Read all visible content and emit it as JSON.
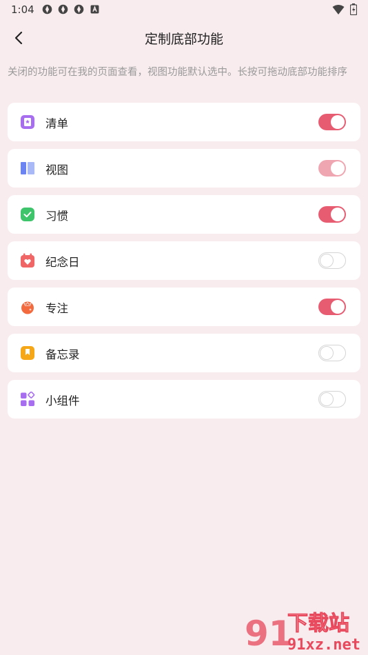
{
  "status_bar": {
    "time": "1:04",
    "icons": [
      "app-notification-icon",
      "app-notification-icon",
      "app-notification-icon",
      "a-badge-icon"
    ],
    "right_icons": [
      "wifi-icon",
      "battery-icon"
    ]
  },
  "header": {
    "back_icon": "chevron-left-icon",
    "title": "定制底部功能"
  },
  "hint": "关闭的功能可在我的页面查看，视图功能默认选中。长按可拖动底部功能排序",
  "items": [
    {
      "label": "清单",
      "icon": "checklist-icon",
      "icon_color": "#a86ef0",
      "enabled": true,
      "locked": false
    },
    {
      "label": "视图",
      "icon": "view-icon",
      "icon_color": "#6b84f2",
      "enabled": true,
      "locked": true
    },
    {
      "label": "习惯",
      "icon": "habit-check-icon",
      "icon_color": "#3ec46a",
      "enabled": true,
      "locked": false
    },
    {
      "label": "纪念日",
      "icon": "calendar-heart-icon",
      "icon_color": "#f06565",
      "enabled": false,
      "locked": false
    },
    {
      "label": "专注",
      "icon": "tomato-icon",
      "icon_color": "#f26a3e",
      "enabled": true,
      "locked": false
    },
    {
      "label": "备忘录",
      "icon": "memo-bookmark-icon",
      "icon_color": "#f6a717",
      "enabled": false,
      "locked": false
    },
    {
      "label": "小组件",
      "icon": "widgets-icon",
      "icon_color": "#a86ef0",
      "enabled": false,
      "locked": false
    }
  ],
  "colors": {
    "background": "#f8ecee",
    "toggle_on": "#e85c72",
    "toggle_on_locked": "#f0a6b1"
  },
  "watermark": {
    "text_top": "下载站",
    "text_bottom": "91xz.net",
    "logo": "91"
  }
}
